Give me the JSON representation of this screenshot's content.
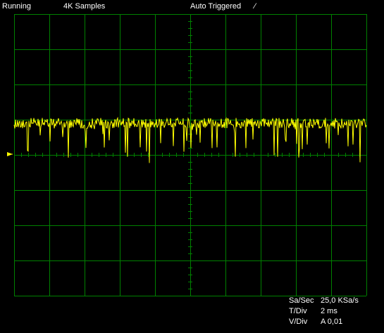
{
  "status_bar": {
    "run_state": "Running",
    "samples": "4K Samples",
    "trigger_mode": "Auto Triggered",
    "trigger_slope_symbol": "⁄"
  },
  "readouts": {
    "sample_rate": {
      "label": "Sa/Sec",
      "value": "25,0 KSa/s"
    },
    "time_per_div": {
      "label": "T/Div",
      "value": "2 ms"
    },
    "volts_per_div": {
      "label": "V/Div",
      "value": "A 0,01"
    }
  },
  "colors": {
    "background": "#000000",
    "grid": "#008000",
    "trace": "#ffff00",
    "text": "#ffffff"
  },
  "icons": {
    "trigger_level_marker": "arrow-right-icon"
  },
  "display": {
    "horizontal_divisions": 10,
    "vertical_divisions": 8,
    "trace_baseline_divisions_above_center": 0.9,
    "noise_amplitude_divisions": 0.15,
    "spike_depth_divisions_max": 1.0
  }
}
